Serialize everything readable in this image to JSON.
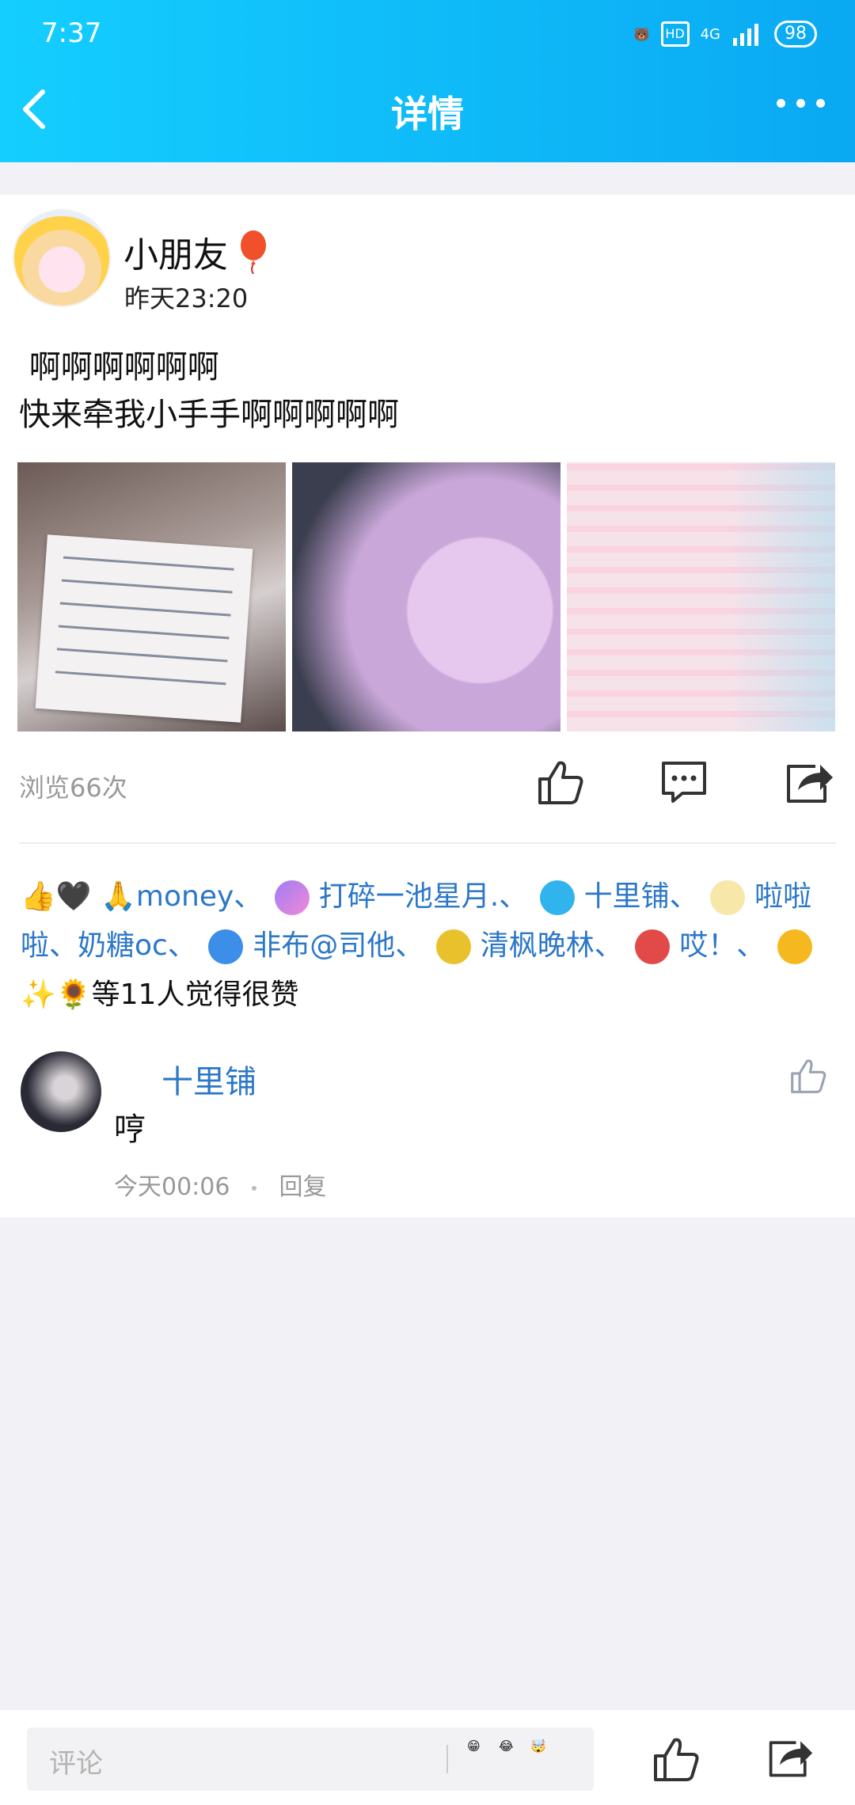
{
  "status_bar": {
    "time": "7:37",
    "hd": "HD",
    "network": "4G",
    "battery": "98"
  },
  "header": {
    "title": "详情"
  },
  "post": {
    "author": "小朋友",
    "time": "昨天23:20",
    "text": " 啊啊啊啊啊啊\n快来牵我小手手啊啊啊啊啊",
    "views": "浏览66次"
  },
  "likes": {
    "parts": [
      "🙏money、",
      "打碎一池星月.、",
      "十里铺、",
      "啦啦啦、奶糖oc、",
      "非布@司他、",
      "清枫晚林、",
      "哎！、"
    ],
    "tail": "✨🌻等11人觉得很赞"
  },
  "comment": {
    "name": "十里铺",
    "text": "哼",
    "time": "今天00:06",
    "reply": "回复"
  },
  "bottom_bar": {
    "placeholder": "评论",
    "emojis": [
      "😁",
      "😂",
      "🤯"
    ]
  }
}
